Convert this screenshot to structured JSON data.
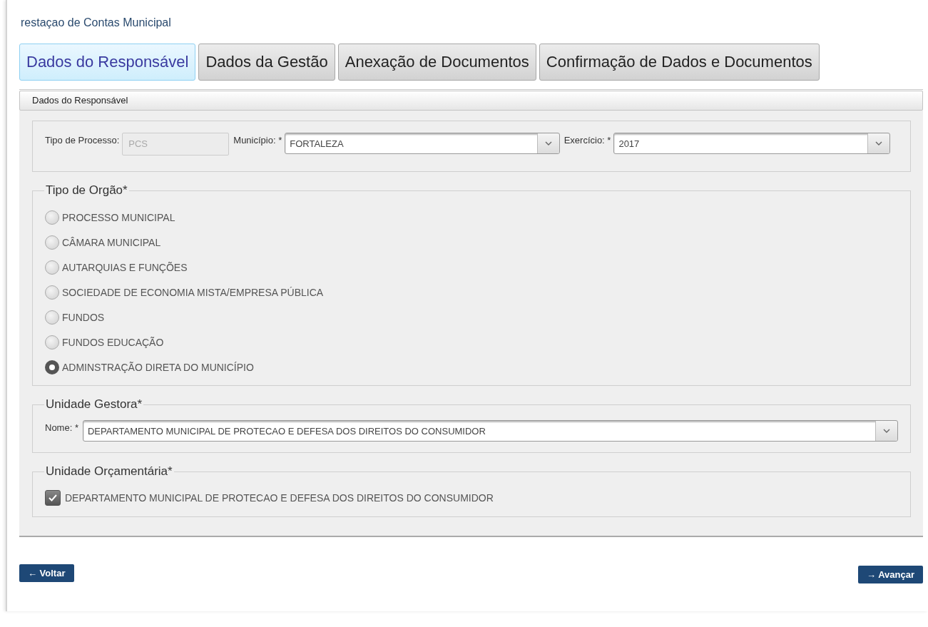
{
  "page_title": "restaçao de Contas Municipal",
  "tabs": [
    {
      "label": "Dados do Responsável",
      "selected": true
    },
    {
      "label": "Dados da Gestão",
      "selected": false
    },
    {
      "label": "Anexação de Documentos",
      "selected": false
    },
    {
      "label": "Confirmação de Dados e Documentos",
      "selected": false
    }
  ],
  "panel": {
    "title": "Dados do Responsável",
    "process_fields": [
      {
        "kind": "text",
        "label": "Tipo de Processo:",
        "value": "PCS",
        "disabled": true
      },
      {
        "kind": "select",
        "label": "Município: *",
        "value": "FORTALEZA",
        "disabled": false
      },
      {
        "kind": "select",
        "label": "Exercício: *",
        "value": "2017",
        "disabled": false
      }
    ],
    "tipo_orgao": {
      "legend": "Tipo de Orgão*",
      "options": [
        {
          "label": "PROCESSO MUNICIPAL",
          "selected": false
        },
        {
          "label": "CÂMARA MUNICIPAL",
          "selected": false
        },
        {
          "label": "AUTARQUIAS E FUNÇÕES",
          "selected": false
        },
        {
          "label": "SOCIEDADE DE ECONOMIA MISTA/EMPRESA PÚBLICA",
          "selected": false
        },
        {
          "label": "FUNDOS",
          "selected": false
        },
        {
          "label": "FUNDOS EDUCAÇÃO",
          "selected": false
        },
        {
          "label": "ADMINSTRAÇÃO DIRETA DO MUNICÍPIO",
          "selected": true
        }
      ]
    },
    "unidade_gestora": {
      "legend": "Unidade Gestora*",
      "label": "Nome: *",
      "value": "DEPARTAMENTO MUNICIPAL DE PROTECAO E DEFESA DOS DIREITOS DO CONSUMIDOR"
    },
    "unidade_orcamentaria": {
      "legend": "Unidade Orçamentária*",
      "items": [
        {
          "label": "DEPARTAMENTO MUNICIPAL DE PROTECAO E DEFESA DOS DIREITOS DO CONSUMIDOR",
          "checked": true
        }
      ]
    }
  },
  "buttons": [
    {
      "kind": "back",
      "label": "← Voltar"
    },
    {
      "kind": "next",
      "label": "→ Avançar"
    }
  ]
}
